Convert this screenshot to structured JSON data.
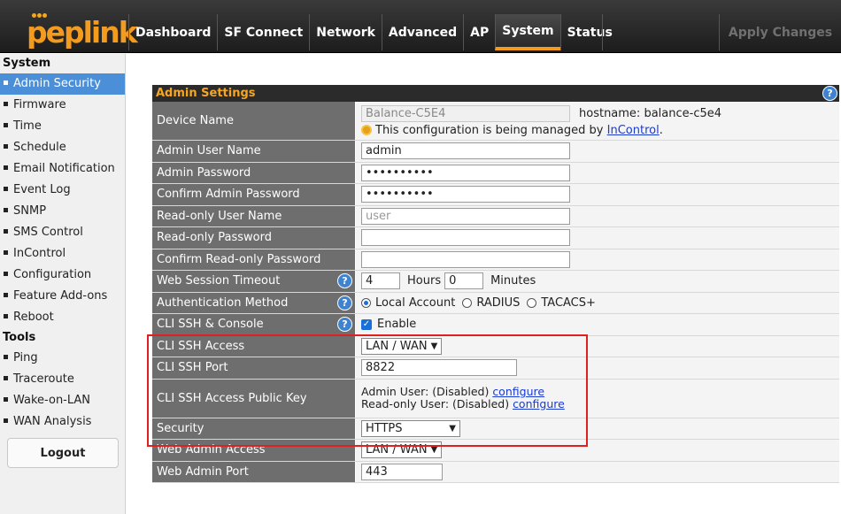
{
  "brand": {
    "logo_text": "peplink",
    "accent": "#f39b1e"
  },
  "nav": {
    "tabs": [
      {
        "label": "Dashboard"
      },
      {
        "label": "SF Connect"
      },
      {
        "label": "Network"
      },
      {
        "label": "Advanced"
      },
      {
        "label": "AP"
      },
      {
        "label": "System",
        "active": true
      },
      {
        "label": "Status"
      }
    ],
    "apply_label": "Apply Changes"
  },
  "sidebar": {
    "system_heading": "System",
    "system_items": [
      {
        "label": "Admin Security",
        "active": true
      },
      {
        "label": "Firmware"
      },
      {
        "label": "Time"
      },
      {
        "label": "Schedule"
      },
      {
        "label": "Email Notification"
      },
      {
        "label": "Event Log"
      },
      {
        "label": "SNMP"
      },
      {
        "label": "SMS Control"
      },
      {
        "label": "InControl"
      },
      {
        "label": "Configuration"
      },
      {
        "label": "Feature Add-ons"
      },
      {
        "label": "Reboot"
      }
    ],
    "tools_heading": "Tools",
    "tools_items": [
      {
        "label": "Ping"
      },
      {
        "label": "Traceroute"
      },
      {
        "label": "Wake-on-LAN"
      },
      {
        "label": "WAN Analysis"
      }
    ],
    "logout_label": "Logout"
  },
  "admin_settings": {
    "title": "Admin Settings",
    "device_name": {
      "label": "Device Name",
      "value": "Balance-C5E4",
      "hostname_text": "hostname: balance-c5e4",
      "managed_text": "This configuration is being managed by",
      "managed_link": "InControl",
      "managed_suffix": "."
    },
    "admin_user_name": {
      "label": "Admin User Name",
      "value": "admin"
    },
    "admin_password": {
      "label": "Admin Password",
      "value": "••••••••••"
    },
    "confirm_admin_password": {
      "label": "Confirm Admin Password",
      "value": "••••••••••"
    },
    "readonly_user_name": {
      "label": "Read-only User Name",
      "placeholder": "user"
    },
    "readonly_password": {
      "label": "Read-only Password",
      "value": ""
    },
    "confirm_readonly_password": {
      "label": "Confirm Read-only Password",
      "value": ""
    },
    "web_session_timeout": {
      "label": "Web Session Timeout",
      "hours": "4",
      "hours_label": "Hours",
      "minutes": "0",
      "minutes_label": "Minutes"
    },
    "authentication_method": {
      "label": "Authentication Method",
      "options": [
        "Local Account",
        "RADIUS",
        "TACACS+"
      ],
      "selected": "Local Account"
    },
    "cli_ssh_console": {
      "label": "CLI SSH & Console",
      "checkbox_label": "Enable",
      "checked": true
    },
    "cli_ssh_access": {
      "label": "CLI SSH Access",
      "value": "LAN / WAN"
    },
    "cli_ssh_port": {
      "label": "CLI SSH Port",
      "value": "8822"
    },
    "cli_ssh_public_key": {
      "label": "CLI SSH Access Public Key",
      "admin_text": "Admin User: (Disabled)",
      "readonly_text": "Read-only User: (Disabled)",
      "configure_label": "configure"
    },
    "security": {
      "label": "Security",
      "value": "HTTPS"
    },
    "web_admin_access": {
      "label": "Web Admin Access",
      "value": "LAN / WAN"
    },
    "web_admin_port": {
      "label": "Web Admin Port",
      "value": "443"
    }
  },
  "colors": {
    "header_bg": "#2b2b2b",
    "label_bg": "#6e6e6e",
    "highlight": "#e02020",
    "active_item": "#4a8fd8"
  }
}
